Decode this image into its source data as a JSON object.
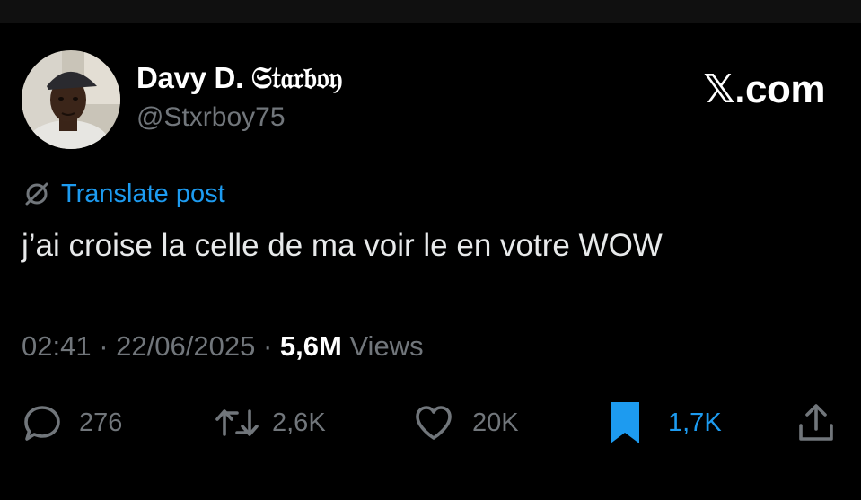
{
  "author": {
    "display_name": "Davy D. 𝔖𝔱𝔞𝔯𝔟𝔬𝔶",
    "handle": "@Stxrboy75"
  },
  "site_label": "𝕏.com",
  "translate_label": "Translate post",
  "post_text": "j’ai croise la celle de ma voir le en votre WOW",
  "meta": {
    "time": "02:41",
    "separator": "·",
    "date": "22/06/2025",
    "views_count": "5,6M",
    "views_label": "Views"
  },
  "actions": {
    "replies": "276",
    "reposts": "2,6K",
    "likes": "20K",
    "bookmarks": "1,7K"
  },
  "colors": {
    "background": "#000000",
    "accent": "#1d9bf0",
    "muted": "#71767b",
    "text": "#e7e9ea"
  },
  "icons": [
    "reply-icon",
    "repost-icon",
    "like-icon",
    "bookmark-icon",
    "share-icon",
    "translate-icon"
  ]
}
